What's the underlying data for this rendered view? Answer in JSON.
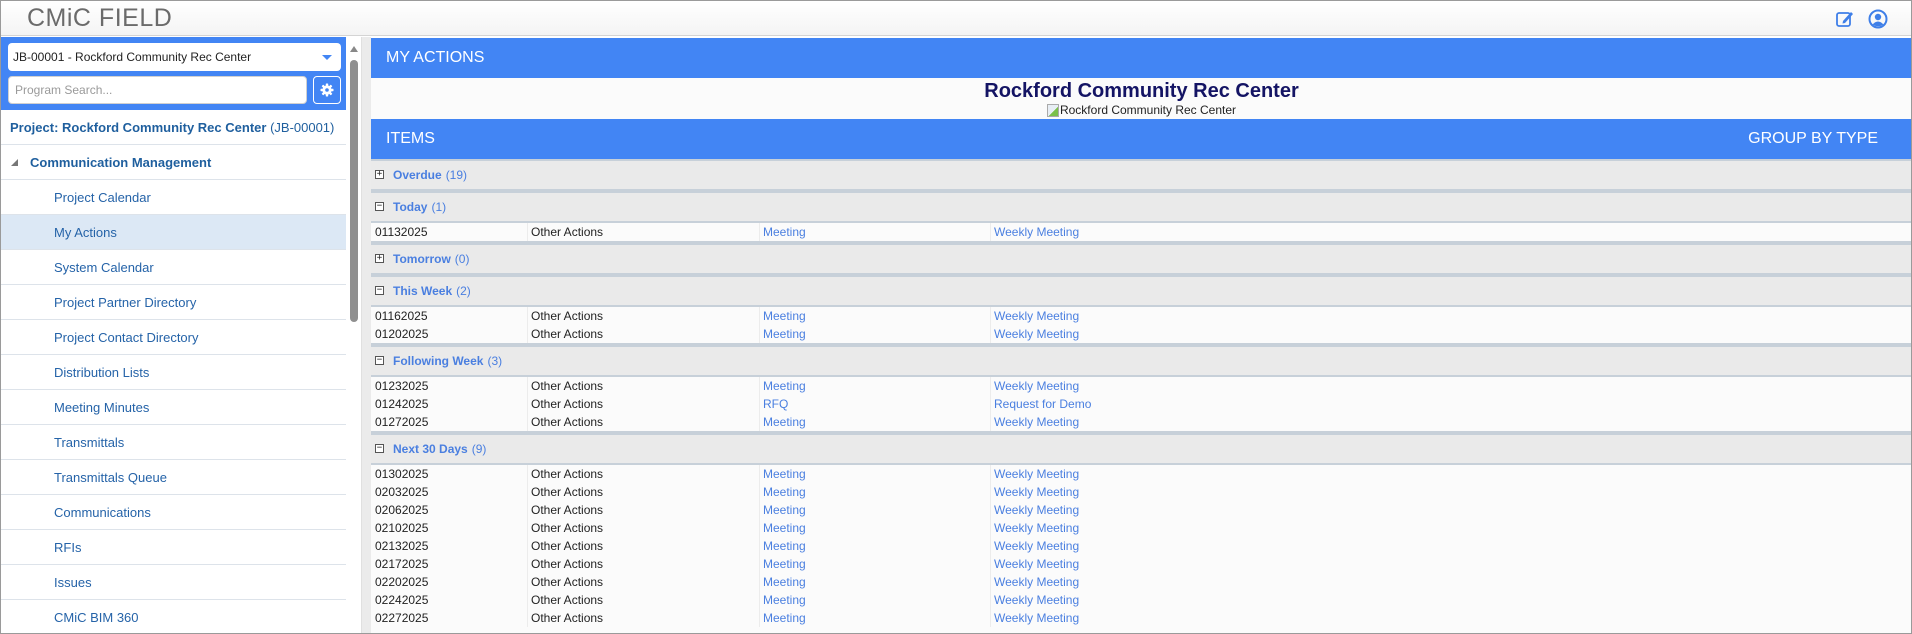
{
  "app": {
    "logo": "CMiC FIELD",
    "icons": {
      "edit": "edit-note-icon",
      "user": "user-account-icon"
    }
  },
  "sidebar": {
    "project_select": "JB-00001 - Rockford Community Rec Center",
    "search_placeholder": "Program Search...",
    "settings_icon": "gear-icon",
    "project_label": "Project: Rockford Community Rec Center",
    "project_code": "(JB-00001)",
    "group": "Communication Management",
    "items": [
      {
        "label": "Project Calendar",
        "active": false
      },
      {
        "label": "My Actions",
        "active": true
      },
      {
        "label": "System Calendar",
        "active": false
      },
      {
        "label": "Project Partner Directory",
        "active": false
      },
      {
        "label": "Project Contact Directory",
        "active": false
      },
      {
        "label": "Distribution Lists",
        "active": false
      },
      {
        "label": "Meeting Minutes",
        "active": false
      },
      {
        "label": "Transmittals",
        "active": false
      },
      {
        "label": "Transmittals Queue",
        "active": false
      },
      {
        "label": "Communications",
        "active": false
      },
      {
        "label": "RFIs",
        "active": false
      },
      {
        "label": "Issues",
        "active": false
      },
      {
        "label": "CMiC BIM 360",
        "active": false
      }
    ]
  },
  "main": {
    "section_title": "MY ACTIONS",
    "project_title": "Rockford Community Rec Center",
    "project_image_alt": "Rockford Community Rec Center",
    "items_title": "ITEMS",
    "group_by": "GROUP BY TYPE",
    "groups": [
      {
        "label": "Overdue",
        "count": "(19)",
        "expanded": false,
        "rows": []
      },
      {
        "label": "Today",
        "count": "(1)",
        "expanded": true,
        "rows": [
          [
            "01132025",
            "Other Actions",
            "Meeting",
            "Weekly Meeting"
          ]
        ]
      },
      {
        "label": "Tomorrow",
        "count": "(0)",
        "expanded": false,
        "rows": []
      },
      {
        "label": "This Week",
        "count": "(2)",
        "expanded": true,
        "rows": [
          [
            "01162025",
            "Other Actions",
            "Meeting",
            "Weekly Meeting"
          ],
          [
            "01202025",
            "Other Actions",
            "Meeting",
            "Weekly Meeting"
          ]
        ]
      },
      {
        "label": "Following Week",
        "count": "(3)",
        "expanded": true,
        "rows": [
          [
            "01232025",
            "Other Actions",
            "Meeting",
            "Weekly Meeting"
          ],
          [
            "01242025",
            "Other Actions",
            "RFQ",
            "Request for Demo"
          ],
          [
            "01272025",
            "Other Actions",
            "Meeting",
            "Weekly Meeting"
          ]
        ]
      },
      {
        "label": "Next 30 Days",
        "count": "(9)",
        "expanded": true,
        "rows": [
          [
            "01302025",
            "Other Actions",
            "Meeting",
            "Weekly Meeting"
          ],
          [
            "02032025",
            "Other Actions",
            "Meeting",
            "Weekly Meeting"
          ],
          [
            "02062025",
            "Other Actions",
            "Meeting",
            "Weekly Meeting"
          ],
          [
            "02102025",
            "Other Actions",
            "Meeting",
            "Weekly Meeting"
          ],
          [
            "02132025",
            "Other Actions",
            "Meeting",
            "Weekly Meeting"
          ],
          [
            "02172025",
            "Other Actions",
            "Meeting",
            "Weekly Meeting"
          ],
          [
            "02202025",
            "Other Actions",
            "Meeting",
            "Weekly Meeting"
          ],
          [
            "02242025",
            "Other Actions",
            "Meeting",
            "Weekly Meeting"
          ],
          [
            "02272025",
            "Other Actions",
            "Meeting",
            "Weekly Meeting"
          ]
        ]
      }
    ]
  },
  "colors": {
    "accent": "#4285f4",
    "link": "#4a7fe0",
    "sidebar_text": "#2563a8",
    "title_navy": "#141464",
    "active_item_bg": "#dce8f5"
  }
}
